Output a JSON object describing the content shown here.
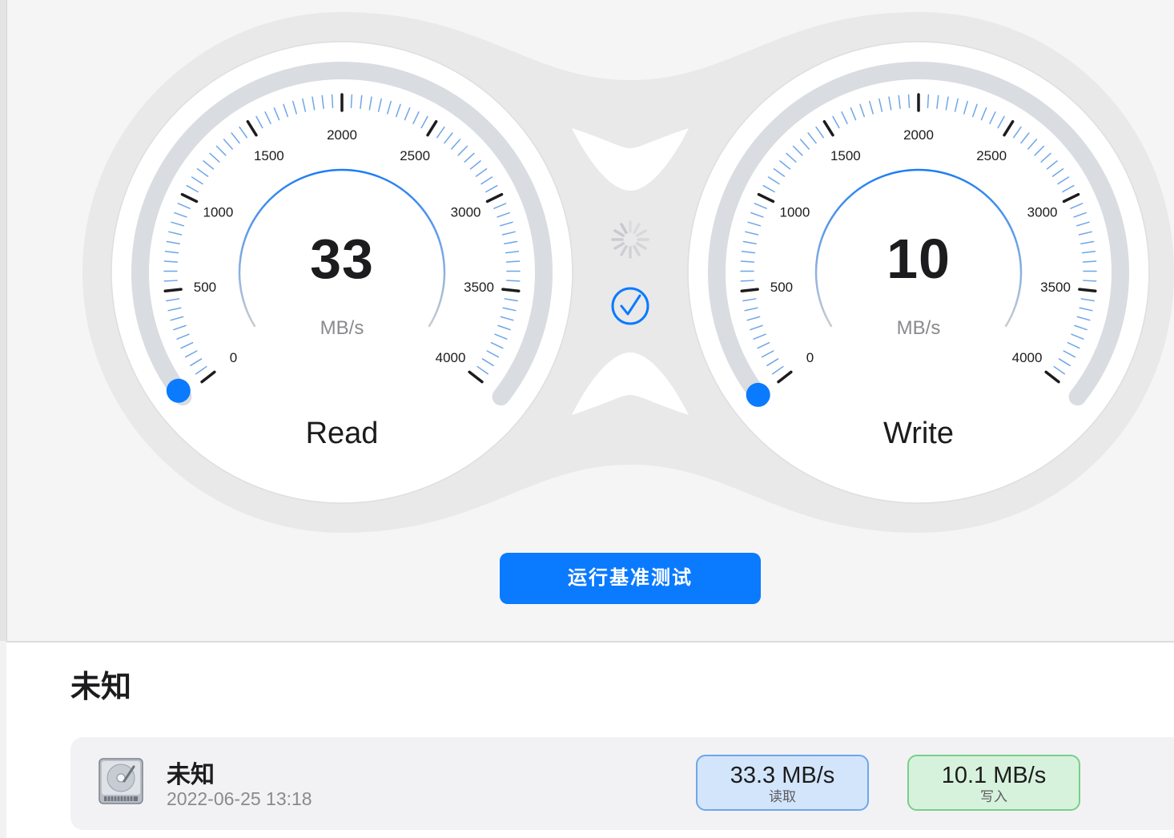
{
  "gauges": [
    {
      "id": "read",
      "name": "Read",
      "value_display": "33",
      "unit": "MB/s",
      "value": 33,
      "max": 4000,
      "ticks": [
        "0",
        "500",
        "1000",
        "1500",
        "2000",
        "2500",
        "3000",
        "3500",
        "4000"
      ]
    },
    {
      "id": "write",
      "name": "Write",
      "value_display": "10",
      "unit": "MB/s",
      "value": 10,
      "max": 4000,
      "ticks": [
        "0",
        "500",
        "1000",
        "1500",
        "2000",
        "2500",
        "3000",
        "3500",
        "4000"
      ]
    }
  ],
  "status": {
    "spinner_icon": "spinner-icon",
    "check_icon": "checkmark-circle-icon"
  },
  "run_button_label": "运行基准测试",
  "section_title": "未知",
  "results": [
    {
      "name": "未知",
      "date": "2022-06-25 13:18",
      "read_value": "33.3 MB/s",
      "read_label": "读取",
      "write_value": "10.1 MB/s",
      "write_label": "写入",
      "icon": "hard-drive-icon"
    }
  ],
  "colors": {
    "accent": "#0a7aff",
    "read_badge": "#d3e5fb",
    "write_badge": "#d7f2dc"
  }
}
